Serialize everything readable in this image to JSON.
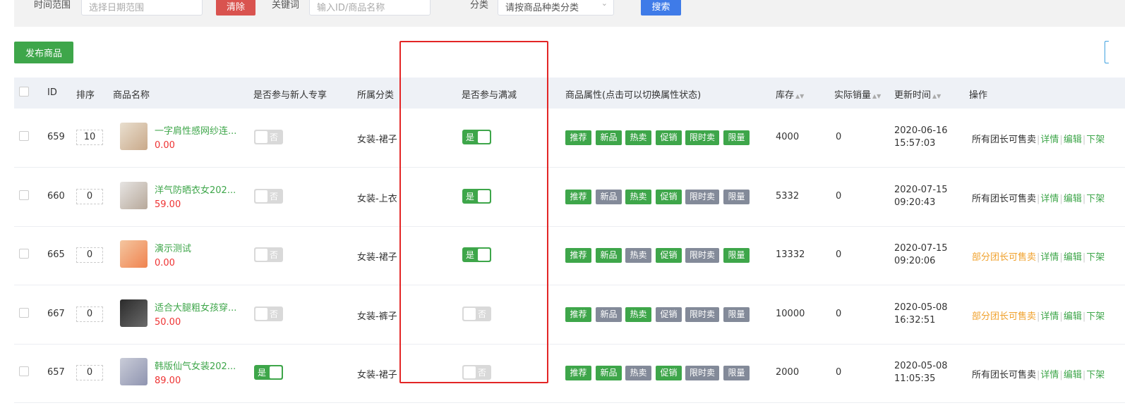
{
  "filter": {
    "date_label": "时间范围",
    "date_placeholder": "选择日期范围",
    "clear_label": "清除",
    "keyword_label": "关键词",
    "keyword_placeholder": "输入ID/商品名称",
    "category_label": "分类",
    "category_value": "请按商品种类分类",
    "search_label": "搜索"
  },
  "publish_label": "发布商品",
  "columns": {
    "id": "ID",
    "sort": "排序",
    "name": "商品名称",
    "newcomer": "是否参与新人专享",
    "category": "所属分类",
    "discount": "是否参与满减",
    "attrs": "商品属性(点击可以切换属性状态)",
    "stock": "库存",
    "sales": "实际销量",
    "updated": "更新时间",
    "ops": "操作"
  },
  "tag_labels": [
    "推荐",
    "新品",
    "热卖",
    "促销",
    "限时卖",
    "限量"
  ],
  "toggle_on": "是",
  "toggle_off": "否",
  "op_links": {
    "detail": "详情",
    "edit": "编辑",
    "offline": "下架"
  },
  "rows": [
    {
      "id": "659",
      "sort": "10",
      "name": "一字肩性感网纱连...",
      "price": "0.00",
      "newcomer": false,
      "category": "女装-裙子",
      "discount": true,
      "tags": [
        true,
        true,
        true,
        true,
        true,
        true
      ],
      "stock": "4000",
      "sales": "0",
      "date": "2020-06-16",
      "time": "15:57:03",
      "seller": "所有团长可售卖",
      "seller_type": "all"
    },
    {
      "id": "660",
      "sort": "0",
      "name": "洋气防晒衣女202...",
      "price": "59.00",
      "newcomer": false,
      "category": "女装-上衣",
      "discount": true,
      "tags": [
        true,
        false,
        true,
        true,
        false,
        false
      ],
      "stock": "5332",
      "sales": "0",
      "date": "2020-07-15",
      "time": "09:20:43",
      "seller": "所有团长可售卖",
      "seller_type": "all"
    },
    {
      "id": "665",
      "sort": "0",
      "name": "演示测试",
      "price": "0.00",
      "newcomer": false,
      "category": "女装-裙子",
      "discount": true,
      "tags": [
        true,
        true,
        false,
        true,
        false,
        true
      ],
      "stock": "13332",
      "sales": "0",
      "date": "2020-07-15",
      "time": "09:20:06",
      "seller": "部分团长可售卖",
      "seller_type": "part"
    },
    {
      "id": "667",
      "sort": "0",
      "name": "适合大腿粗女孩穿...",
      "price": "50.00",
      "newcomer": false,
      "category": "女装-裤子",
      "discount": false,
      "tags": [
        true,
        false,
        true,
        false,
        false,
        false
      ],
      "stock": "10000",
      "sales": "0",
      "date": "2020-05-08",
      "time": "16:32:51",
      "seller": "部分团长可售卖",
      "seller_type": "part"
    },
    {
      "id": "657",
      "sort": "0",
      "name": "韩版仙气女装202...",
      "price": "89.00",
      "newcomer": true,
      "category": "女装-裙子",
      "discount": false,
      "tags": [
        true,
        true,
        false,
        true,
        false,
        false
      ],
      "stock": "2000",
      "sales": "0",
      "date": "2020-05-08",
      "time": "11:05:35",
      "seller": "所有团长可售卖",
      "seller_type": "all"
    }
  ],
  "colors": {
    "accent_green": "#3ea64a",
    "tag_gray": "#838a99",
    "price_red": "#e33333",
    "partial_orange": "#f0a12c",
    "highlight_red": "#e32525",
    "search_blue": "#3f7be8"
  }
}
